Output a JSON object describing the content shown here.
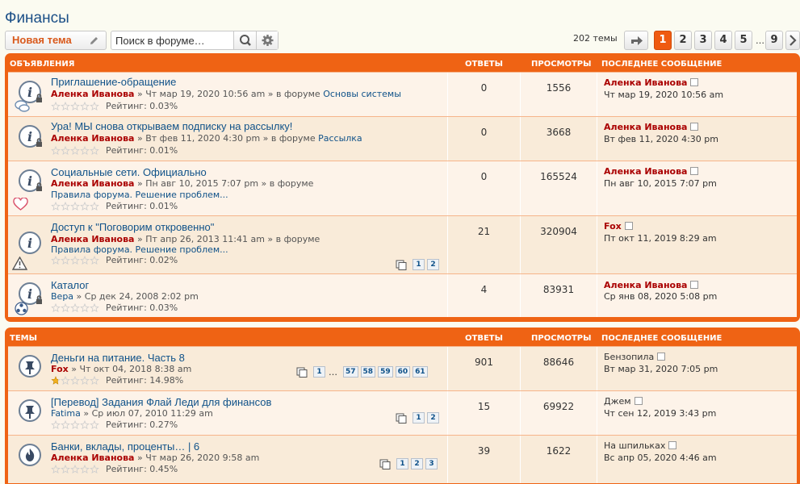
{
  "page": {
    "title": "Финансы"
  },
  "toolbar": {
    "new_topic_label": "Новая тема",
    "search_placeholder": "Поиск в форуме…",
    "topic_count": "202 темы",
    "pages": [
      "1",
      "2",
      "3",
      "4",
      "5",
      "9"
    ],
    "ellipsis": "…"
  },
  "announcements": {
    "headers": {
      "title": "ОБЪЯВЛЕНИЯ",
      "replies": "ОТВЕТЫ",
      "views": "ПРОСМОТРЫ",
      "last_post": "ПОСЛЕДНЕЕ СООБЩЕНИЕ"
    },
    "rows": [
      {
        "title": "Приглашение-обращение",
        "author": "Аленка Иванова",
        "meta": " » Чт мар 19, 2020 10:56 am » в форуме ",
        "forum": "Основы системы",
        "rating": "Рейтинг: 0.03%",
        "replies": "0",
        "views": "1556",
        "lp_author": "Аленка Иванова",
        "lp_date": "Чт мар 19, 2020 10:56 am"
      },
      {
        "title": "Ура! МЫ снова открываем подписку на рассылку!",
        "author": "Аленка Иванова",
        "meta": " » Вт фев 11, 2020 4:30 pm » в форуме ",
        "forum": "Рассылка",
        "rating": "Рейтинг: 0.01%",
        "replies": "0",
        "views": "3668",
        "lp_author": "Аленка Иванова",
        "lp_date": "Вт фев 11, 2020 4:30 pm"
      },
      {
        "title": "Социальные сети. Официально",
        "author": "Аленка Иванова",
        "meta": " » Пн авг 10, 2015 7:07 pm » в форуме",
        "desc": "Правила форума. Решение проблем...",
        "rating": "Рейтинг: 0.01%",
        "replies": "0",
        "views": "165524",
        "lp_author": "Аленка Иванова",
        "lp_date": "Пн авг 10, 2015 7:07 pm"
      },
      {
        "title": "Доступ к \"Поговорим откровенно\"",
        "author": "Аленка Иванова",
        "meta": " » Пт апр 26, 2013 11:41 am » в форуме",
        "desc": "Правила форума. Решение проблем...",
        "rating": "Рейтинг: 0.02%",
        "replies": "21",
        "views": "320904",
        "lp_author": "Fox",
        "lp_date": "Пт окт 11, 2019 8:29 am",
        "pages": [
          "1",
          "2"
        ]
      },
      {
        "title": "Каталог",
        "author": "Вера",
        "meta": " » Ср дек 24, 2008 2:02 pm",
        "rating": "Рейтинг: 0.03%",
        "replies": "4",
        "views": "83931",
        "lp_author": "Аленка Иванова",
        "lp_date": "Ср янв 08, 2020 5:08 pm"
      }
    ]
  },
  "topics": {
    "headers": {
      "title": "ТЕМЫ",
      "replies": "ОТВЕТЫ",
      "views": "ПРОСМОТРЫ",
      "last_post": "ПОСЛЕДНЕЕ СООБЩЕНИЕ"
    },
    "rows": [
      {
        "title": "Деньги на питание. Часть 8",
        "author": "Fox",
        "meta": " » Чт окт 04, 2018 8:38 am",
        "rating": "Рейтинг: 14.98%",
        "replies": "901",
        "views": "88646",
        "lp_author": "Бензопила",
        "lp_date": "Вт мар 31, 2020 7:05 pm",
        "pages": [
          "1",
          "57",
          "58",
          "59",
          "60",
          "61"
        ],
        "rating_fill": 0.15
      },
      {
        "title": "[Перевод] Задания Флай Леди для финансов",
        "author": "Fatima",
        "meta": " » Ср июл 07, 2010 11:29 am",
        "rating": "Рейтинг: 0.27%",
        "replies": "15",
        "views": "69922",
        "lp_author": "Джем",
        "lp_date": "Чт сен 12, 2019 3:43 pm",
        "pages": [
          "1",
          "2"
        ]
      },
      {
        "title": "Банки, вклады, проценты… | 6",
        "author": "Аленка Иванова",
        "meta": " » Чт мар 26, 2020 9:58 am",
        "rating": "Рейтинг: 0.45%",
        "replies": "39",
        "views": "1622",
        "lp_author": "На шпильках",
        "lp_date": "Вс апр 05, 2020 4:46 am",
        "pages": [
          "1",
          "2",
          "3"
        ]
      }
    ]
  },
  "colors": {
    "accent": "#ef6314",
    "title_link": "#105289",
    "author": "#aa0000",
    "active_page": "#ef5a10"
  }
}
